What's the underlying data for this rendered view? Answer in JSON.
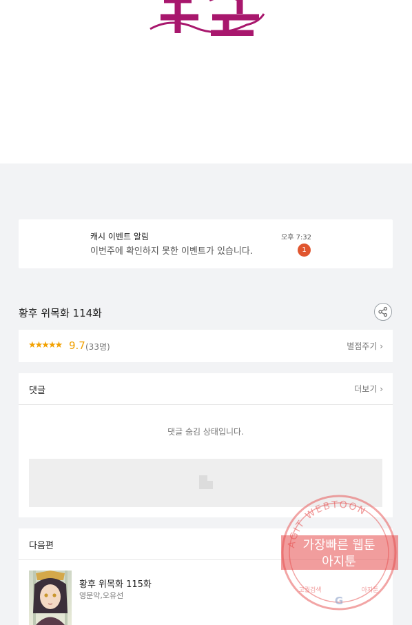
{
  "notice": {
    "title": "캐시 이벤트 알림",
    "message": "이번주에 확인하지 못한 이벤트가 있습니다.",
    "time": "오후 7:32",
    "badge": "1"
  },
  "episode": {
    "title": "황후 위목화 114화",
    "stars": "★★★★★",
    "score": "9.7",
    "count": "(33명)",
    "rate_label": "별점주기 ›"
  },
  "comments": {
    "header": "댓글",
    "more": "더보기 ›",
    "hidden_message": "댓글 숨김 상태입니다."
  },
  "next": {
    "header": "다음편",
    "title": "황후 위목화 115화",
    "author": "영문악,오유선"
  },
  "watermark": {
    "arc_text": "AGIT WEBTOON",
    "line1": "가장빠른 웹툰",
    "line2": "아지툰",
    "small_left": "고퀄검색",
    "small_right": "아지툰"
  },
  "colors": {
    "logo": "#a8176d",
    "badge": "#e0562f",
    "star": "#f2a100",
    "stamp": "#e64c4c"
  }
}
